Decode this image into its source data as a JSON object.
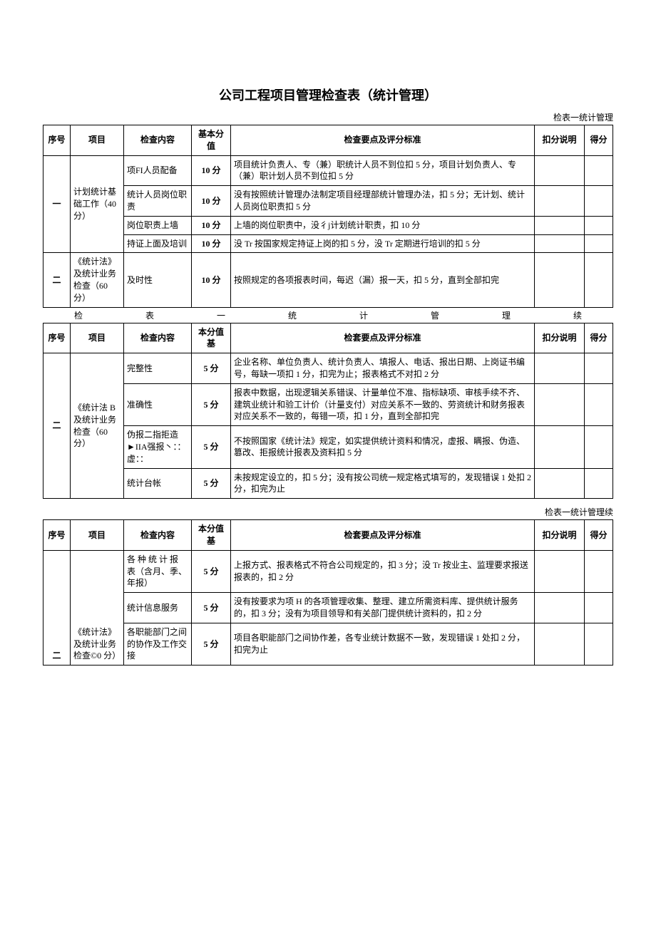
{
  "title": "公司工程项目管理检查表（统计管理）",
  "caption1": "检表一统计管理",
  "caption2": {
    "c1": "检",
    "c2": "表",
    "c3": "一",
    "c4": "统",
    "c5": "计",
    "c6": "管",
    "c7": "理",
    "c8": "续"
  },
  "caption3": "检表一统计管理续",
  "headers": {
    "seq": "序号",
    "item": "项目",
    "content": "检查内容",
    "base1": "基本分值",
    "base2": "本分值基",
    "criteria1": "检查要点及评分标准",
    "criteria2": "检套要点及评分标准",
    "deduct": "扣分说明",
    "final": "得分"
  },
  "t1": {
    "seq1": "一",
    "item1": "计划统计基础工作（40 分）",
    "r1": {
      "content": "项FI人员配备",
      "score": "10 分",
      "criteria": "项目统计负责人、专（兼）职统计人员不到位扣 5 分，项目计划负责人、专（兼）职计划人员不到位扣 5 分"
    },
    "r2": {
      "content": "统计人员岗位职责",
      "score": "10 分",
      "criteria": "没有按照统计管理办法制定项目经理部统计管理办法，扣 5 分；无计划、统计人员岗位职责扣 5 分"
    },
    "r3": {
      "content": "岗位职责上墙",
      "score": "10 分",
      "criteria": "上墙的岗位职责中，没彳j计划统计职责，扣 10 分"
    },
    "r4": {
      "content": "持证上面及培训",
      "score": "10 分",
      "criteria": "没 Tr 按国家规定持证上岗的扣 5 分，没 Tr 定期进行培训的扣 5 分"
    },
    "seq2": "二",
    "item2": "《统计法》及统计业务检查（60 分）",
    "r5": {
      "content": "及时性",
      "score": "10 分",
      "criteria": "按照规定的各项报表时间，每迟（漏）报一天，扣 5 分，直到全部扣完"
    }
  },
  "t2": {
    "seq": "二",
    "item": "《统计法 B 及统计业务检查（60 分）",
    "r1": {
      "content": "完整性",
      "score": "5 分",
      "criteria": "企业名称、单位负责人、统计负责人、填报人、电话、报出日期、上岗证书编号，每缺一项扣 1 分，扣完为止；报表格式不对扣 2 分"
    },
    "r2": {
      "content": "准确性",
      "score": "5 分",
      "criteria": "报表中数据，出现逻辑关系错误、计量单位不准、指标缺项、审核手续不齐、建筑业统计和验工计价（计量支付）对应关系不一致的、劳资统计和财务报表对应关系不一致的，每错一项，扣 1 分，直到全部扣完"
    },
    "r3": {
      "content": "伪报二指拒造►IIA强报丶：：虚：：",
      "score": "5 分",
      "criteria": "不按照国家《统计法》规定，如实提供统计资料和情况，虚报、瞒报、伪造、篡改、拒报统计报表及资料扣 5 分"
    },
    "r4": {
      "content": "统计台帐",
      "score": "5 分",
      "criteria": "未按规定设立的，扣 5 分；没有按公司统一规定格式填写的，发现错误 1 处扣 2 分，扣完为止"
    }
  },
  "t3": {
    "seq": "二",
    "item": "《统计法》及统计业务检查©0 分）",
    "r1": {
      "content": "各 种 统 计 报 表（含月、季、年报）",
      "score": "5 分",
      "criteria": "上报方式、报表格式不符合公司规定的，扣 3 分；没 Tr 按业主、监理要求报送报表的，扣 2 分"
    },
    "r2": {
      "content": "统计信息服务",
      "score": "5 分",
      "criteria": "没有按要求为项 H 的各项管理收集、整理、建立所需资料库、提供统计服务的，扣 3 分；没有为项目领导和有关部门提供统计资料的，扣 2 分"
    },
    "r3": {
      "content": "各职能部门之间的协作及工作交接",
      "score": "5 分",
      "criteria": "项目各职能部门之间协作差，各专业统计数据不一致，发现错误 1 处扣 2 分，扣完为止"
    }
  }
}
